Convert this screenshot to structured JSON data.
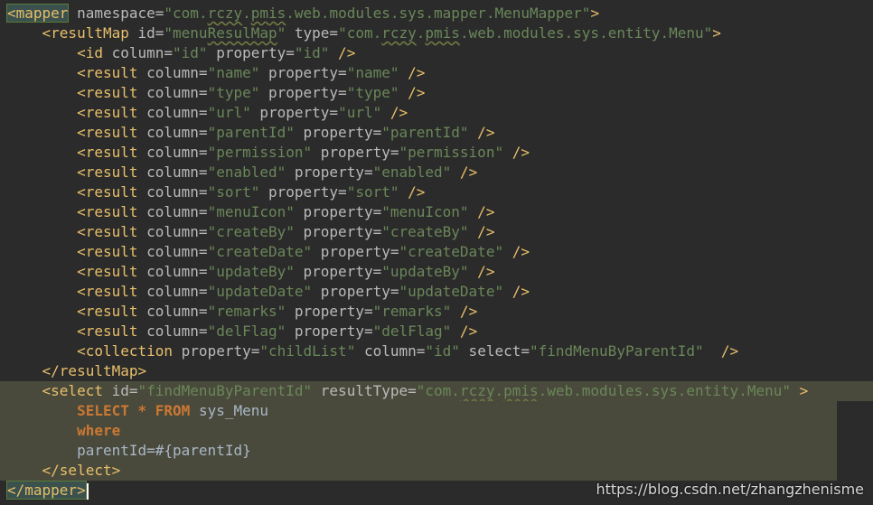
{
  "editor": {
    "lines": [
      {
        "tokens": [
          [
            "tag",
            "<mapper"
          ],
          [
            "attr",
            " namespace="
          ],
          [
            "val",
            "\"com."
          ],
          [
            "val",
            "rczy"
          ],
          [
            "val",
            "."
          ],
          [
            "val",
            "pmis"
          ],
          [
            "val",
            ".web.modules.sys.mapper.MenuMapper\""
          ],
          [
            "tag",
            ">"
          ]
        ]
      },
      {
        "tokens": [
          [
            "plain",
            "    "
          ],
          [
            "tag",
            "<resultMap"
          ],
          [
            "attr",
            " id="
          ],
          [
            "val",
            "\"menu"
          ],
          [
            "val",
            "ResulMap"
          ],
          [
            "val",
            "\""
          ],
          [
            "attr",
            " type="
          ],
          [
            "val",
            "\"com."
          ],
          [
            "val",
            "rczy"
          ],
          [
            "val",
            "."
          ],
          [
            "val",
            "pmis"
          ],
          [
            "val",
            ".web.modules.sys.entity.Menu\""
          ],
          [
            "tag",
            ">"
          ]
        ]
      },
      {
        "tokens": [
          [
            "plain",
            "        "
          ],
          [
            "tag",
            "<id"
          ],
          [
            "attr",
            " column="
          ],
          [
            "val",
            "\"id\""
          ],
          [
            "attr",
            " property="
          ],
          [
            "val",
            "\"id\""
          ],
          [
            "tag",
            " />"
          ]
        ]
      },
      {
        "tokens": [
          [
            "plain",
            "        "
          ],
          [
            "tag",
            "<result"
          ],
          [
            "attr",
            " column="
          ],
          [
            "val",
            "\"name\""
          ],
          [
            "attr",
            " property="
          ],
          [
            "val",
            "\"name\""
          ],
          [
            "tag",
            " />"
          ]
        ]
      },
      {
        "tokens": [
          [
            "plain",
            "        "
          ],
          [
            "tag",
            "<result"
          ],
          [
            "attr",
            " column="
          ],
          [
            "val",
            "\"type\""
          ],
          [
            "attr",
            " property="
          ],
          [
            "val",
            "\"type\""
          ],
          [
            "tag",
            " />"
          ]
        ]
      },
      {
        "tokens": [
          [
            "plain",
            "        "
          ],
          [
            "tag",
            "<result"
          ],
          [
            "attr",
            " column="
          ],
          [
            "val",
            "\"url\""
          ],
          [
            "attr",
            " property="
          ],
          [
            "val",
            "\"url\""
          ],
          [
            "tag",
            " />"
          ]
        ]
      },
      {
        "tokens": [
          [
            "plain",
            "        "
          ],
          [
            "tag",
            "<result"
          ],
          [
            "attr",
            " column="
          ],
          [
            "val",
            "\"parentId\""
          ],
          [
            "attr",
            " property="
          ],
          [
            "val",
            "\"parentId\""
          ],
          [
            "tag",
            " />"
          ]
        ]
      },
      {
        "tokens": [
          [
            "plain",
            "        "
          ],
          [
            "tag",
            "<result"
          ],
          [
            "attr",
            " column="
          ],
          [
            "val",
            "\"permission\""
          ],
          [
            "attr",
            " property="
          ],
          [
            "val",
            "\"permission\""
          ],
          [
            "tag",
            " />"
          ]
        ]
      },
      {
        "tokens": [
          [
            "plain",
            "        "
          ],
          [
            "tag",
            "<result"
          ],
          [
            "attr",
            " column="
          ],
          [
            "val",
            "\"enabled\""
          ],
          [
            "attr",
            " property="
          ],
          [
            "val",
            "\"enabled\""
          ],
          [
            "tag",
            " />"
          ]
        ]
      },
      {
        "tokens": [
          [
            "plain",
            "        "
          ],
          [
            "tag",
            "<result"
          ],
          [
            "attr",
            " column="
          ],
          [
            "val",
            "\"sort\""
          ],
          [
            "attr",
            " property="
          ],
          [
            "val",
            "\"sort\""
          ],
          [
            "tag",
            " />"
          ]
        ]
      },
      {
        "tokens": [
          [
            "plain",
            "        "
          ],
          [
            "tag",
            "<result"
          ],
          [
            "attr",
            " column="
          ],
          [
            "val",
            "\"menuIcon\""
          ],
          [
            "attr",
            " property="
          ],
          [
            "val",
            "\"menuIcon\""
          ],
          [
            "tag",
            " />"
          ]
        ]
      },
      {
        "tokens": [
          [
            "plain",
            "        "
          ],
          [
            "tag",
            "<result"
          ],
          [
            "attr",
            " column="
          ],
          [
            "val",
            "\"createBy\""
          ],
          [
            "attr",
            " property="
          ],
          [
            "val",
            "\"createBy\""
          ],
          [
            "tag",
            " />"
          ]
        ]
      },
      {
        "tokens": [
          [
            "plain",
            "        "
          ],
          [
            "tag",
            "<result"
          ],
          [
            "attr",
            " column="
          ],
          [
            "val",
            "\"createDate\""
          ],
          [
            "attr",
            " property="
          ],
          [
            "val",
            "\"createDate\""
          ],
          [
            "tag",
            " />"
          ]
        ]
      },
      {
        "tokens": [
          [
            "plain",
            "        "
          ],
          [
            "tag",
            "<result"
          ],
          [
            "attr",
            " column="
          ],
          [
            "val",
            "\"updateBy\""
          ],
          [
            "attr",
            " property="
          ],
          [
            "val",
            "\"updateBy\""
          ],
          [
            "tag",
            " />"
          ]
        ]
      },
      {
        "tokens": [
          [
            "plain",
            "        "
          ],
          [
            "tag",
            "<result"
          ],
          [
            "attr",
            " column="
          ],
          [
            "val",
            "\"updateDate\""
          ],
          [
            "attr",
            " property="
          ],
          [
            "val",
            "\"updateDate\""
          ],
          [
            "tag",
            " />"
          ]
        ]
      },
      {
        "tokens": [
          [
            "plain",
            "        "
          ],
          [
            "tag",
            "<result"
          ],
          [
            "attr",
            " column="
          ],
          [
            "val",
            "\"remarks\""
          ],
          [
            "attr",
            " property="
          ],
          [
            "val",
            "\"remarks\""
          ],
          [
            "tag",
            " />"
          ]
        ]
      },
      {
        "tokens": [
          [
            "plain",
            "        "
          ],
          [
            "tag",
            "<result"
          ],
          [
            "attr",
            " column="
          ],
          [
            "val",
            "\"delFlag\""
          ],
          [
            "attr",
            " property="
          ],
          [
            "val",
            "\"delFlag\""
          ],
          [
            "tag",
            " />"
          ]
        ]
      },
      {
        "tokens": [
          [
            "plain",
            "        "
          ],
          [
            "tag",
            "<collection"
          ],
          [
            "attr",
            " property="
          ],
          [
            "val",
            "\"childList\""
          ],
          [
            "attr",
            " column="
          ],
          [
            "val",
            "\"id\""
          ],
          [
            "attr",
            " select="
          ],
          [
            "val",
            "\"findMenuByParentId\""
          ],
          [
            "tag",
            "  />"
          ]
        ]
      },
      {
        "tokens": [
          [
            "plain",
            "    "
          ],
          [
            "tag",
            "</resultMap>"
          ]
        ]
      },
      {
        "tokens": [
          [
            "plain",
            "    "
          ],
          [
            "tag",
            "<select"
          ],
          [
            "attr",
            " id="
          ],
          [
            "val",
            "\"findMenuByParentId\""
          ],
          [
            "attr",
            " resultType="
          ],
          [
            "val",
            "\"com."
          ],
          [
            "val",
            "rczy"
          ],
          [
            "val",
            "."
          ],
          [
            "val",
            "pmis"
          ],
          [
            "val",
            ".web.modules.sys.entity.Menu\""
          ],
          [
            "tag",
            " >"
          ]
        ]
      },
      {
        "tokens": [
          [
            "plain",
            "        "
          ],
          [
            "kw",
            "SELECT"
          ],
          [
            "plain",
            " "
          ],
          [
            "kw",
            "*"
          ],
          [
            "plain",
            " "
          ],
          [
            "kw",
            "FROM"
          ],
          [
            "plain",
            " sys_Menu"
          ]
        ]
      },
      {
        "tokens": [
          [
            "plain",
            "        "
          ],
          [
            "kw",
            "where"
          ]
        ]
      },
      {
        "tokens": [
          [
            "plain",
            "        parentId=#{parentId}"
          ]
        ]
      },
      {
        "tokens": [
          [
            "plain",
            "    "
          ],
          [
            "tag",
            "</select>"
          ]
        ]
      },
      {
        "tokens": [
          [
            "tag",
            "</mapper>"
          ]
        ]
      }
    ],
    "highlight": {
      "from": 19,
      "to": 23,
      "full": [
        19
      ]
    },
    "typo_words": [
      "rczy",
      "pmis",
      "ResulMap"
    ]
  },
  "watermark": "https://blog.csdn.net/zhangzhenisme",
  "colors": {
    "background": "#2b2b2b",
    "tag": "#e8bf6a",
    "attribute": "#bababa",
    "value": "#6a8759",
    "keyword": "#cc7832",
    "text": "#a9b7c6",
    "highlight": "#4a4a3c"
  }
}
